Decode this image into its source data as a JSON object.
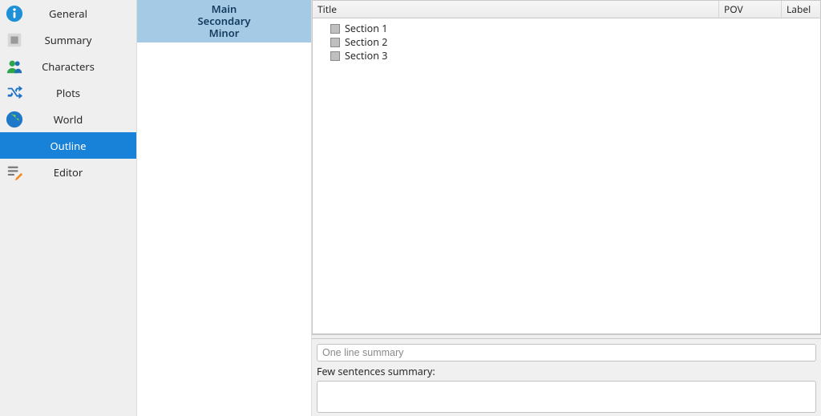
{
  "sidebar": {
    "items": [
      {
        "label": "General",
        "icon": "info"
      },
      {
        "label": "Summary",
        "icon": "summary"
      },
      {
        "label": "Characters",
        "icon": "people"
      },
      {
        "label": "Plots",
        "icon": "shuffle"
      },
      {
        "label": "World",
        "icon": "globe"
      },
      {
        "label": "Outline",
        "icon": "",
        "selected": true
      },
      {
        "label": "Editor",
        "icon": "editor"
      }
    ]
  },
  "categories": {
    "items": [
      "Main",
      "Secondary",
      "Minor"
    ]
  },
  "tree": {
    "columns": {
      "title": "Title",
      "pov": "POV",
      "label": "Label"
    },
    "rows": [
      {
        "title": "Section 1"
      },
      {
        "title": "Section 2"
      },
      {
        "title": "Section 3"
      }
    ]
  },
  "bottom": {
    "one_line_placeholder": "One line summary",
    "few_sentences_label": "Few sentences summary:"
  }
}
